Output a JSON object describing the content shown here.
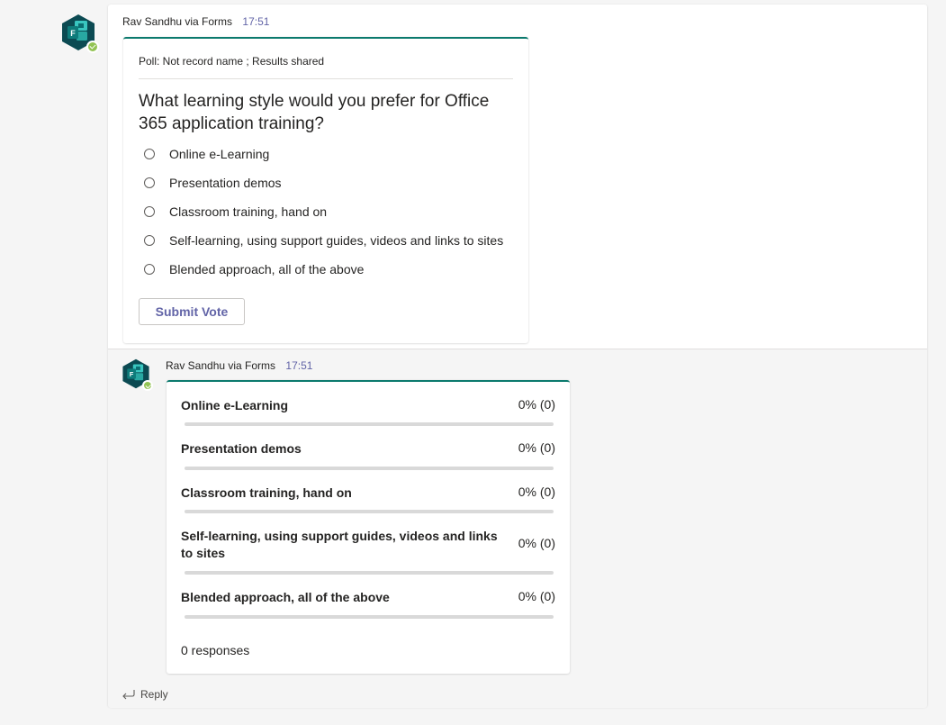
{
  "poll_message": {
    "sender": "Rav Sandhu via Forms",
    "time": "17:51",
    "subtitle": "Poll: Not record name ; Results shared",
    "question": "What learning style would you prefer for Office 365 application training?",
    "options": [
      "Online e-Learning",
      "Presentation demos",
      "Classroom training, hand on",
      "Self-learning, using support guides, videos and links to sites",
      "Blended approach, all of the above"
    ],
    "submit_label": "Submit Vote"
  },
  "results_message": {
    "sender": "Rav Sandhu via Forms",
    "time": "17:51",
    "results": [
      {
        "label": "Online e-Learning",
        "percent_text": "0% (0)",
        "fraction": 0
      },
      {
        "label": "Presentation demos",
        "percent_text": "0% (0)",
        "fraction": 0
      },
      {
        "label": "Classroom training, hand on",
        "percent_text": "0% (0)",
        "fraction": 0
      },
      {
        "label": "Self-learning, using support guides, videos and links to sites",
        "percent_text": "0% (0)",
        "fraction": 0
      },
      {
        "label": "Blended approach, all of the above",
        "percent_text": "0% (0)",
        "fraction": 0
      }
    ],
    "responses": "0 responses"
  },
  "reply_label": "Reply",
  "icons": {
    "avatar": "forms-app-icon",
    "presence": "available-check-icon",
    "reply": "reply-arrow-icon"
  },
  "colors": {
    "accent": "#6264a7",
    "card_top_border": "#0c7a6e",
    "presence": "#92c353"
  }
}
